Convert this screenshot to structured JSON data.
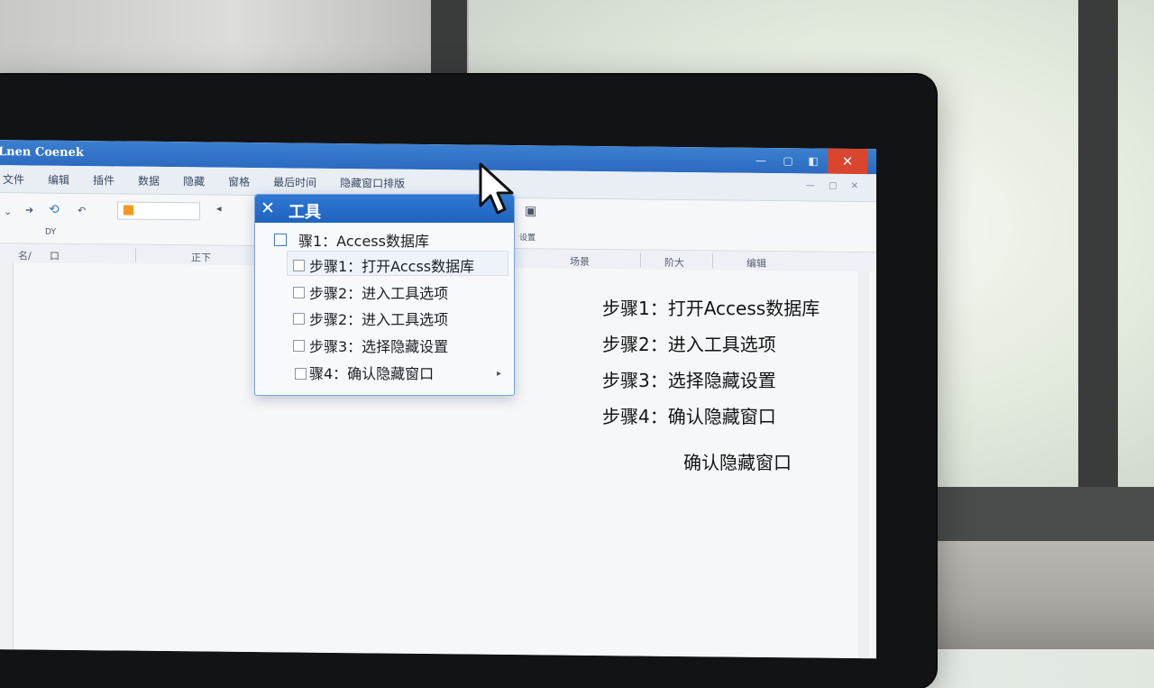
{
  "window": {
    "title": "Lnen Coenek",
    "controls": {
      "minimize": "—",
      "maximize": "▢",
      "restore": "◧",
      "close": "✕"
    }
  },
  "menubar": {
    "items": [
      "文件",
      "编辑",
      "插件",
      "数据",
      "隐藏",
      "窗格",
      "最后时间",
      "隐藏窗口排版"
    ],
    "mini_controls": "— ▢ ✕"
  },
  "ribbon": {
    "group_label": "DY",
    "right_group_label": "设置"
  },
  "columns": {
    "headers": [
      "名/",
      "口",
      "正下",
      "场景",
      "阶大",
      "编辑"
    ]
  },
  "tool_panel": {
    "title": "工具",
    "close_icon": "close-icon",
    "main_item": "骤1：Access数据库",
    "items": [
      "步骤1：打开Accss数据库",
      "步骤2：进入工具选项",
      "步骤2：进入工具选项",
      "步骤3：选择隐藏设置",
      "骤4：确认隐藏窗口"
    ]
  },
  "steps": [
    "步骤1：打开Access数据库",
    "步骤2：进入工具选项",
    "步骤3：选择隐藏设置",
    "步骤4：确认隐藏窗口"
  ],
  "confirm_note": "确认隐藏窗口",
  "colors": {
    "titlebar": "#2b6bc0",
    "close_button": "#d9452f",
    "panel_header": "#1f63be",
    "bezel": "#121314"
  }
}
